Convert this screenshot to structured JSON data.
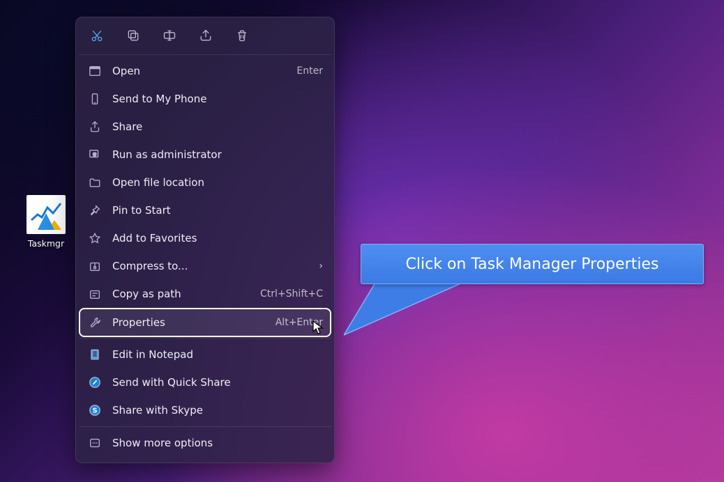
{
  "desktop": {
    "icon_label": "Taskmgr"
  },
  "toolbar": {
    "cut": "cut-icon",
    "copy": "copy-icon",
    "rename": "rename-icon",
    "share": "share-icon",
    "delete": "delete-icon"
  },
  "menu": {
    "groups": [
      [
        {
          "label": "Open",
          "shortcut": "Enter",
          "icon": "window"
        },
        {
          "label": "Send to My Phone",
          "icon": "phone"
        },
        {
          "label": "Share",
          "icon": "share"
        },
        {
          "label": "Run as administrator",
          "icon": "shield"
        },
        {
          "label": "Open file location",
          "icon": "folder"
        },
        {
          "label": "Pin to Start",
          "icon": "pin"
        },
        {
          "label": "Add to Favorites",
          "icon": "star"
        },
        {
          "label": "Compress to...",
          "icon": "archive",
          "submenu": true
        },
        {
          "label": "Copy as path",
          "shortcut": "Ctrl+Shift+C",
          "icon": "path"
        },
        {
          "label": "Properties",
          "shortcut": "Alt+Enter",
          "icon": "wrench",
          "highlighted": true
        }
      ],
      [
        {
          "label": "Edit in Notepad",
          "icon": "notepad"
        },
        {
          "label": "Send with Quick Share",
          "icon": "quickshare"
        },
        {
          "label": "Share with Skype",
          "icon": "skype"
        }
      ],
      [
        {
          "label": "Show more options",
          "icon": "more"
        }
      ]
    ],
    "chevron": "›"
  },
  "callout": {
    "text": "Click on Task Manager Properties"
  }
}
